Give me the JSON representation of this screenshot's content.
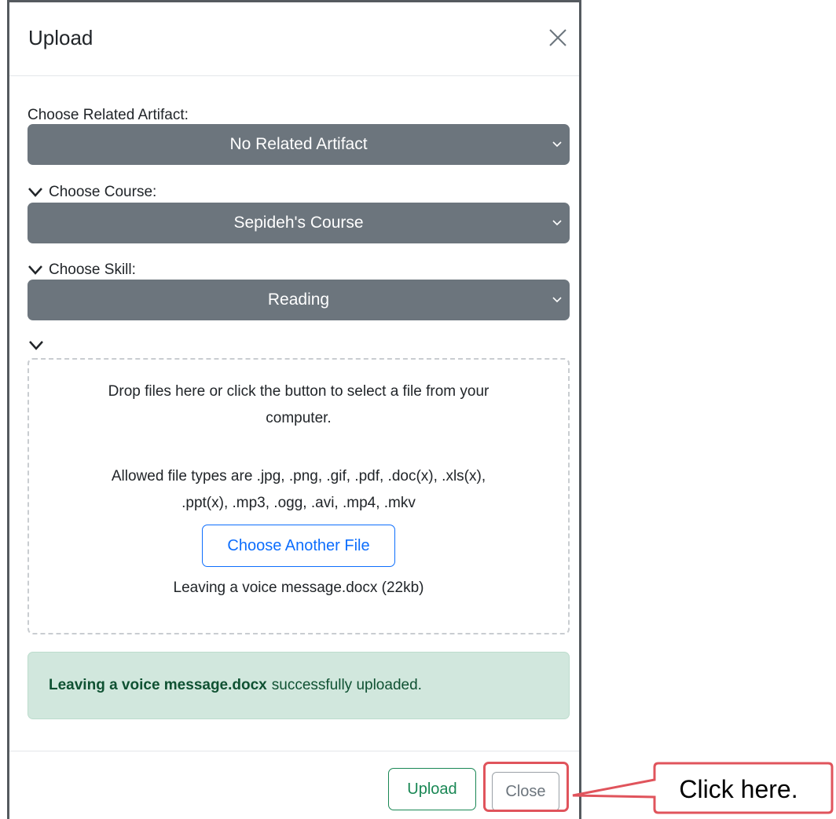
{
  "modal": {
    "title": "Upload",
    "close_icon": "close-x-icon"
  },
  "fields": {
    "artifact": {
      "label": "Choose Related Artifact:",
      "value": "No Related Artifact"
    },
    "course": {
      "label": "Choose Course:",
      "value": "Sepideh's Course"
    },
    "skill": {
      "label": "Choose Skill:",
      "value": "Reading"
    }
  },
  "dropzone": {
    "instruction_line1": "Drop files here or click the button to select a file from your",
    "instruction_line2": "computer.",
    "allowed_line1": "Allowed file types are .jpg, .png, .gif, .pdf, .doc(x), .xls(x),",
    "allowed_line2": ".ppt(x), .mp3, .ogg, .avi, .mp4, .mkv",
    "choose_button": "Choose Another File",
    "file_name": "Leaving a voice message.docx (22kb)"
  },
  "alert": {
    "file": "Leaving a voice message.docx",
    "message": "successfully uploaded."
  },
  "footer": {
    "upload_label": "Upload",
    "close_label": "Close"
  },
  "annotation": {
    "callout_text": "Click here.",
    "highlight_color": "#e0545c"
  },
  "colors": {
    "select_bg": "#6c757d",
    "primary": "#0d6efd",
    "success": "#198754",
    "alert_bg": "#d1e7dd"
  }
}
